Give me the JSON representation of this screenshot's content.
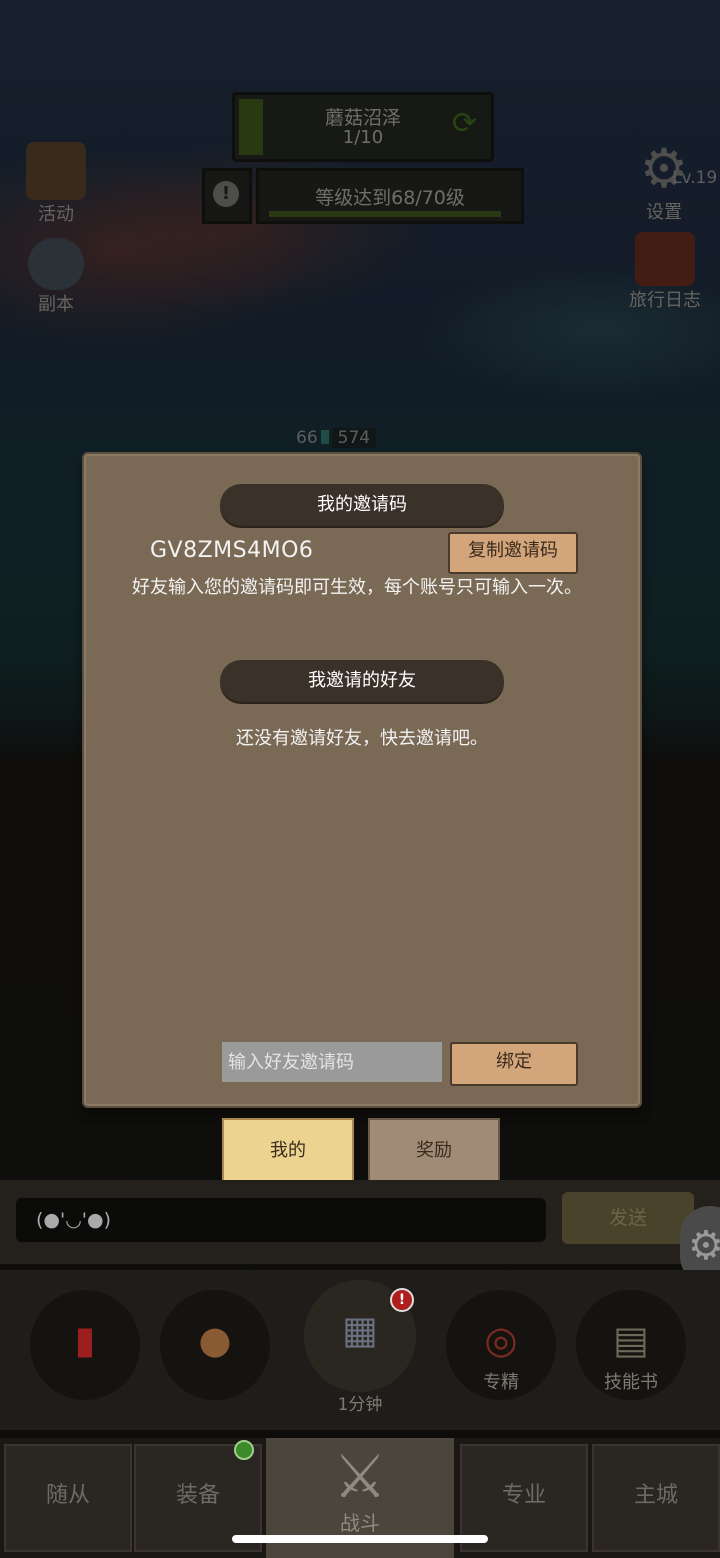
{
  "hud": {
    "stage_name": "蘑菇沼泽",
    "stage_progress": "1/10",
    "quest_text": "等级达到68/70级",
    "level": "Lv.19",
    "hp_level": "66",
    "hp_value": "574"
  },
  "side_menu": {
    "activity": "活动",
    "dungeon": "副本",
    "settings": "设置",
    "travel_log": "旅行日志"
  },
  "dialog": {
    "my_code_title": "我的邀请码",
    "invite_code": "GV8ZMS4MO6",
    "copy_button": "复制邀请码",
    "description": "好友输入您的邀请码即可生效，每个账号只可输入一次。",
    "invited_friends_title": "我邀请的好友",
    "empty_message": "还没有邀请好友，快去邀请吧。",
    "input_placeholder": "输入好友邀请码",
    "bind_button": "绑定"
  },
  "tabs": {
    "mine": "我的",
    "reward": "奖励"
  },
  "chat": {
    "input_value": "(●'◡'●)",
    "send_button": "发送"
  },
  "actions": {
    "timer": "1分钟",
    "specialize": "专精",
    "skill_book": "技能书"
  },
  "nav": {
    "followers": "随从",
    "equipment": "装备",
    "battle": "战斗",
    "profession": "专业",
    "main_city": "主城"
  }
}
